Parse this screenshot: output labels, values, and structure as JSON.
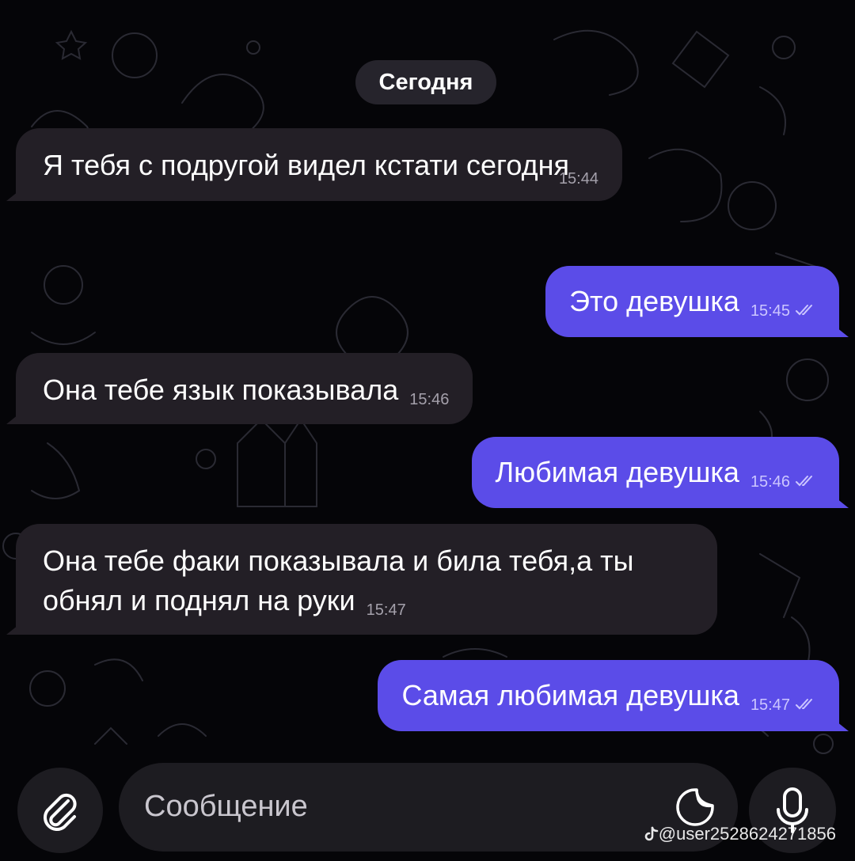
{
  "chat": {
    "date_separator": "Сегодня",
    "messages": [
      {
        "direction": "incoming",
        "text": "Я тебя с подругой видел кстати сегодня",
        "time": "15:44"
      },
      {
        "direction": "outgoing",
        "text": "Это девушка",
        "time": "15:45",
        "status": "read"
      },
      {
        "direction": "incoming",
        "text": "Она тебе язык показывала",
        "time": "15:46"
      },
      {
        "direction": "outgoing",
        "text": "Любимая девушка",
        "time": "15:46",
        "status": "read"
      },
      {
        "direction": "incoming",
        "text": "Она тебе факи показывала и била тебя,а ты обнял и поднял на руки",
        "time": "15:47"
      },
      {
        "direction": "outgoing",
        "text": "Самая любимая девушка",
        "time": "15:47",
        "status": "read"
      }
    ]
  },
  "composer": {
    "placeholder": "Сообщение",
    "attach_icon": "paperclip-icon",
    "sticker_icon": "sticker-icon",
    "mic_icon": "microphone-icon"
  },
  "watermark": {
    "text": "@user2528624271856",
    "icon": "tiktok-logo-icon"
  },
  "colors": {
    "background": "#050508",
    "incoming_bubble": "#231f26",
    "outgoing_bubble": "#5b4ce8",
    "date_pill": "#26242c",
    "composer": "#1d1c21"
  }
}
